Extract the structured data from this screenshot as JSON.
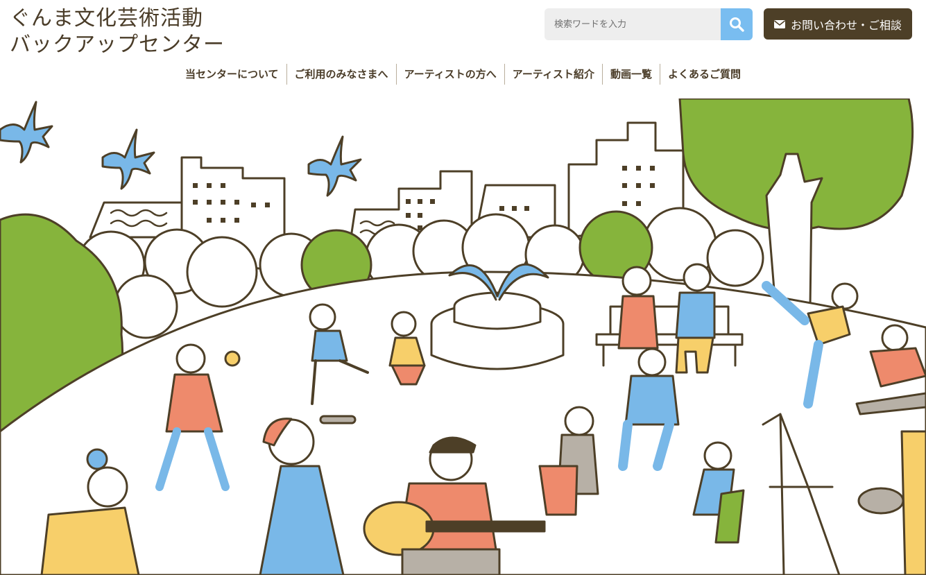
{
  "logo": {
    "line1": "ぐんま文化芸術活動",
    "line2": "バックアップセンター"
  },
  "search": {
    "placeholder": "検索ワードを入力",
    "icon": "search-icon"
  },
  "contact": {
    "label": "お問い合わせ・ご相談",
    "icon": "envelope-icon"
  },
  "nav": {
    "items": [
      {
        "label": "当センターについて"
      },
      {
        "label": "ご利用のみなさまへ"
      },
      {
        "label": "アーティストの方へ"
      },
      {
        "label": "アーティスト紹介"
      },
      {
        "label": "動画一覧"
      },
      {
        "label": "よくあるご質問"
      }
    ]
  },
  "colors": {
    "brown": "#4d3f27",
    "green": "#86b43c",
    "blue": "#79b8e8",
    "orange": "#ee8a6c",
    "yellow": "#f7cf6a",
    "gray": "#b7b0a6"
  }
}
